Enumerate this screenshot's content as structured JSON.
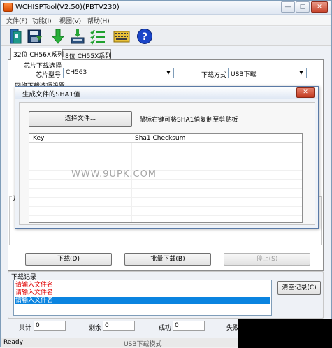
{
  "window": {
    "title": "WCHISPTool(V2.50)(PBTV230)",
    "controls": {
      "minimize": "—",
      "maximize": "□",
      "close": "✕"
    }
  },
  "menu": {
    "items": [
      {
        "label": "文件(F)"
      },
      {
        "label": "功能(I)"
      },
      {
        "label": "视图(V)"
      },
      {
        "label": "帮助(H)"
      }
    ]
  },
  "toolbar": {
    "icons": [
      "open-file-icon",
      "save-config-icon",
      "download-icon",
      "download-config-icon",
      "batch-list-icon",
      "keyboard-icon",
      "help-icon"
    ],
    "help_glyph": "?"
  },
  "tabs": [
    {
      "label": "32位 CH56X系列",
      "active": true
    },
    {
      "label": "8位 CH55X系列",
      "active": false
    }
  ],
  "chip_select": {
    "group_title": "芯片下载选择",
    "chip_model_label": "芯片型号",
    "chip_model_value": "CH563",
    "download_mode_label": "下载方式",
    "download_mode_value": "USB下载"
  },
  "network_group_title": "网络下载选项设置",
  "dropdown_arrow": "▼",
  "partial_label": "开",
  "buttons": {
    "download": "下载(D)",
    "batch_download": "批量下载(B)",
    "stop": "停止(S)",
    "clear_log": "清空记录(C)"
  },
  "log": {
    "group_title": "下载记录",
    "entries": [
      {
        "text": "请输入文件名",
        "selected": false
      },
      {
        "text": "请输入文件名",
        "selected": false
      },
      {
        "text": "请输入文件名",
        "selected": true
      }
    ]
  },
  "stats": {
    "total_label": "共计",
    "total_value": "0",
    "remaining_label": "剩余",
    "remaining_value": "0",
    "success_label": "成功",
    "success_value": "0",
    "fail_label": "失败"
  },
  "statusbar": {
    "status": "Ready",
    "mode": "USB下载模式"
  },
  "dialog": {
    "title": "生成文件的SHA1值",
    "close_glyph": "✕",
    "choose_file_button": "选择文件...",
    "hint": "鼠标右键可将SHA1值复制至剪贴板",
    "columns": [
      "Key",
      "Sha1 Checksum"
    ],
    "watermark": "WWW.9UPK.COM"
  },
  "colors": {
    "log_text": "#e00000",
    "selection": "#0a84e0",
    "title_bar": "#dfe7f2"
  }
}
